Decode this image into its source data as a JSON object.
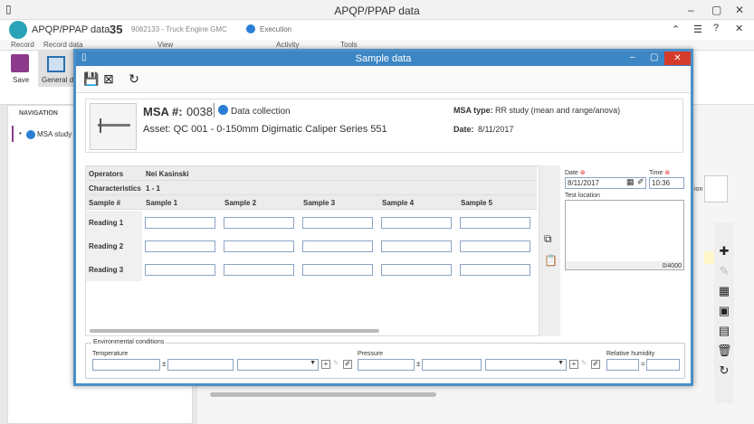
{
  "window": {
    "title": "APQP/PPAP data"
  },
  "appbar": {
    "module": "APQP/PPAP data",
    "record_number": "35",
    "record_desc": "9082133 - Truck Engine GMC",
    "status": "Execution"
  },
  "ribbon": {
    "groups": [
      "Record",
      "Record data",
      "View",
      "Activity",
      "Tools"
    ],
    "save_label": "Save",
    "general_label": "General da"
  },
  "navigation": {
    "header": "NAVIGATION",
    "items": [
      {
        "label": "MSA study"
      }
    ]
  },
  "modal": {
    "title": "Sample data",
    "msa_label": "MSA #:",
    "msa_number": "0038",
    "status": "Data collection",
    "asset": "Asset: QC 001 - 0-150mm Digimatic Caliper Series 551",
    "msa_type_label": "MSA type:",
    "msa_type_value": "RR study (mean and range/anova)",
    "date_label": "Date:",
    "date_value": "8/11/2017",
    "grid": {
      "operators_label": "Operators",
      "operators_value": "Nei Kasinski",
      "characteristics_label": "Characteristics",
      "characteristics_value": "1 - 1",
      "columns": [
        "Sample #",
        "Sample 1",
        "Sample 2",
        "Sample 3",
        "Sample 4",
        "Sample 5"
      ],
      "rows": [
        "Reading 1",
        "Reading 2",
        "Reading 3"
      ]
    },
    "date_field": {
      "label": "Date",
      "value": "8/11/2017"
    },
    "time_field": {
      "label": "Time",
      "value": "10:36"
    },
    "test_location": {
      "label": "Test location",
      "counter": "0/4000"
    },
    "env": {
      "legend": "Environmental conditions",
      "temperature": "Temperature",
      "pressure": "Pressure",
      "humidity": "Relative humidity",
      "plusminus": "±",
      "equals": "="
    }
  },
  "bg_labels": {
    "ion": "ion"
  }
}
